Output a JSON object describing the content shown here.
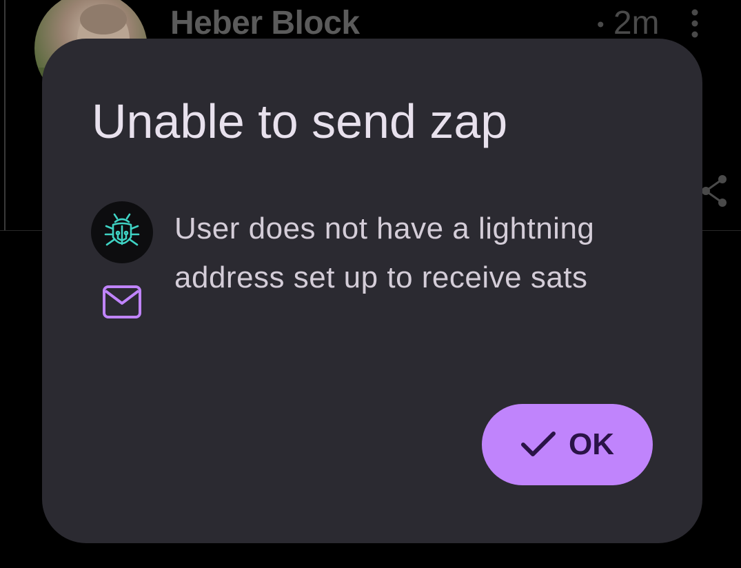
{
  "background_post": {
    "author_name": "Heber Block",
    "time_ago": "2m"
  },
  "dialog": {
    "title": "Unable to send zap",
    "message": "User does not have a lightning address set up to receive sats",
    "ok_label": "OK"
  },
  "colors": {
    "accent": "#c084fc",
    "dialog_bg": "#2b2a31",
    "bug_icon": "#3fd3c4",
    "mail_icon": "#c084fc"
  },
  "icons": {
    "bug": "bug-icon",
    "mail": "mail-icon",
    "check": "check-icon",
    "more": "more-vert-icon",
    "share": "share-icon"
  }
}
